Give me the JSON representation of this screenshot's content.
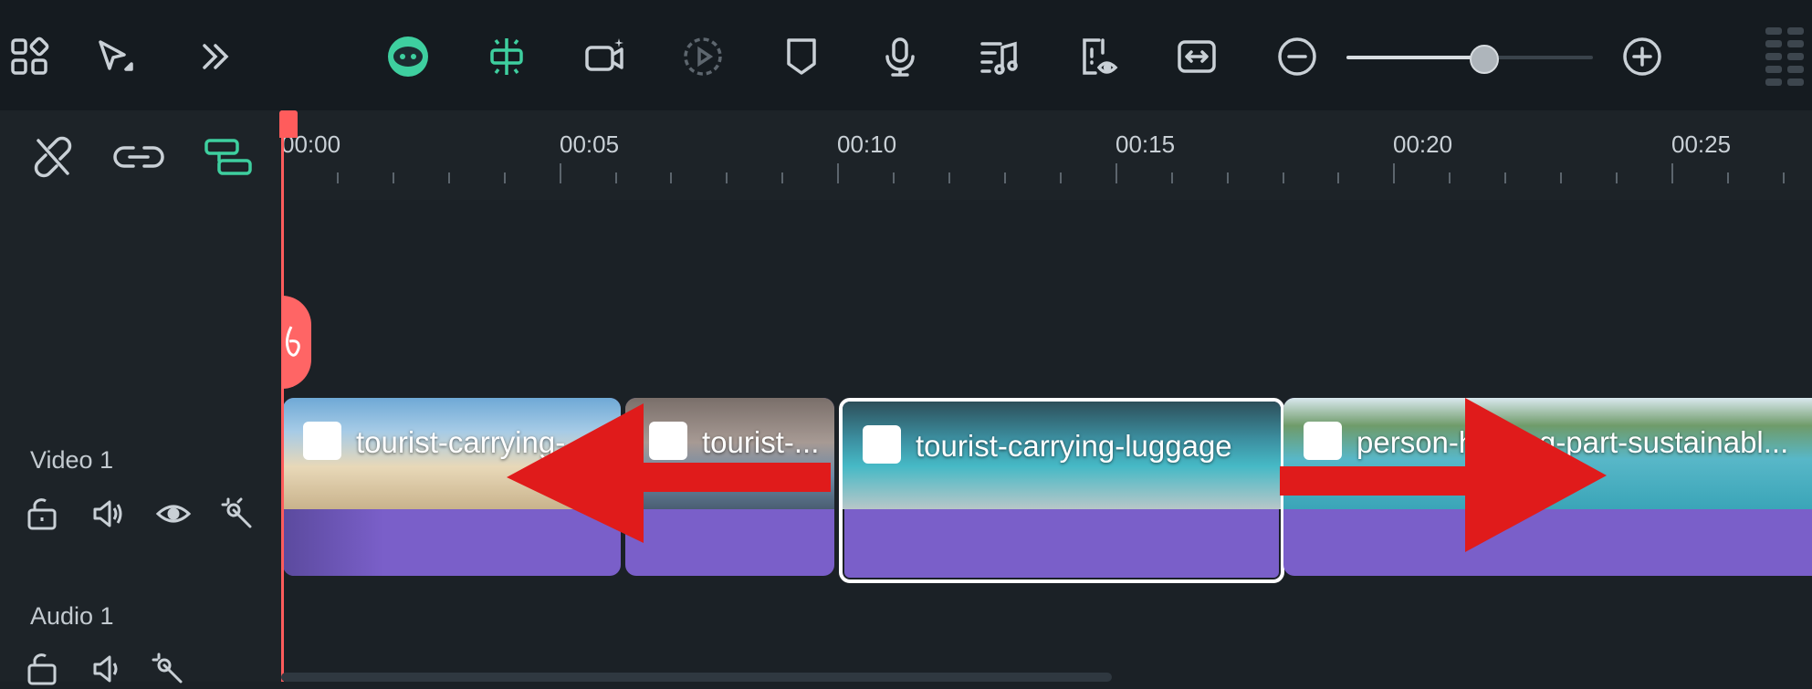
{
  "toolbar": {
    "items": [
      {
        "name": "grid-layout-icon"
      },
      {
        "name": "select-tool-icon"
      },
      {
        "name": "more-tools-icon"
      },
      {
        "name": "ai-assistant-icon"
      },
      {
        "name": "split-marker-icon"
      },
      {
        "name": "ai-camera-icon"
      },
      {
        "name": "play-preview-icon"
      },
      {
        "name": "shield-marker-icon"
      },
      {
        "name": "microphone-icon"
      },
      {
        "name": "music-list-icon"
      },
      {
        "name": "preview-eye-icon"
      },
      {
        "name": "fit-width-icon"
      },
      {
        "name": "zoom-out-icon"
      },
      {
        "name": "zoom-in-icon"
      }
    ],
    "zoom_level": 0.55,
    "accent_color": "#4dd9b0"
  },
  "ruler": {
    "labels": [
      "00:00",
      "00:05",
      "00:10",
      "00:15",
      "00:20",
      "00:25"
    ]
  },
  "tracks": [
    {
      "label": "Video 1",
      "icons": [
        "lock-icon",
        "volume-icon",
        "eye-icon",
        "magic-wand-icon"
      ]
    },
    {
      "label": "Audio 1",
      "icons": [
        "lock-icon",
        "volume-icon",
        "magic-wand-icon"
      ]
    }
  ],
  "clips": [
    {
      "label": "tourist-carrying-",
      "selected": false
    },
    {
      "label": "tourist-...",
      "selected": false
    },
    {
      "label": "tourist-carrying-luggage",
      "selected": true
    },
    {
      "label": "person-holding-part-sustainabl...",
      "selected": false
    }
  ],
  "colors": {
    "clip_purple": "#7a5fc9",
    "playhead_red": "#ff5c5c",
    "arrow_red": "#e01b1b",
    "accent_teal": "#3ecf9f"
  }
}
